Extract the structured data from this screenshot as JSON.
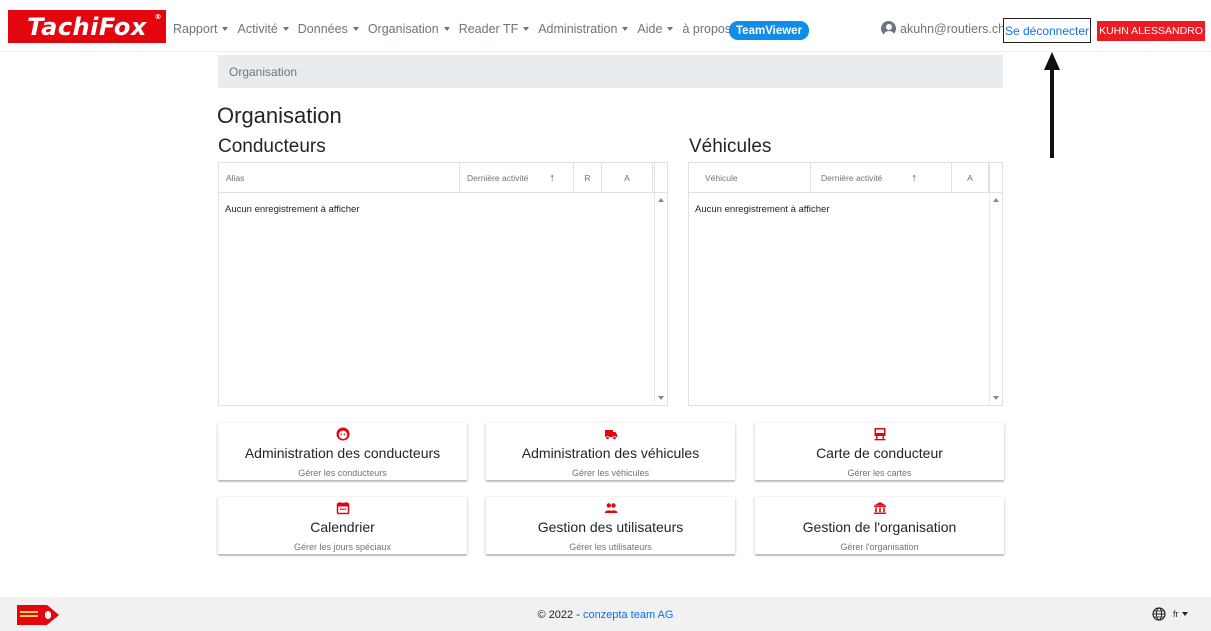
{
  "brand": {
    "logo_text": "TachiFox",
    "reg_mark": "®"
  },
  "nav": {
    "items": [
      {
        "label": "Rapport"
      },
      {
        "label": "Activité"
      },
      {
        "label": "Données"
      },
      {
        "label": "Organisation"
      },
      {
        "label": "Reader TF"
      },
      {
        "label": "Administration"
      },
      {
        "label": "Aide"
      },
      {
        "label": "à propos"
      }
    ],
    "teamviewer_label": "TeamViewer",
    "user_email": "akuhn@routiers.ch",
    "logout_label": "Se déconnecter",
    "user_name": "KUHN ALESSANDRO"
  },
  "breadcrumb": {
    "current": "Organisation"
  },
  "page": {
    "title": "Organisation"
  },
  "drivers": {
    "title": "Conducteurs",
    "columns": [
      "Alias",
      "Dernière activité",
      "↑",
      "R",
      "A"
    ],
    "empty_text": "Aucun enregistrement à afficher"
  },
  "vehicles": {
    "title": "Véhicules",
    "columns": [
      "Véhicule",
      "Dernière activité",
      "↑",
      "A"
    ],
    "empty_text": "Aucun enregistrement à afficher"
  },
  "cards": [
    {
      "icon": "driver-face-icon",
      "title": "Administration des conducteurs",
      "subtitle": "Gérer les conducteurs"
    },
    {
      "icon": "truck-icon",
      "title": "Administration des véhicules",
      "subtitle": "Gérer les véhicules"
    },
    {
      "icon": "card-reader-icon",
      "title": "Carte de conducteur",
      "subtitle": "Gérer les cartes"
    },
    {
      "icon": "calendar-icon",
      "title": "Calendrier",
      "subtitle": "Gérer les jours spéciaux"
    },
    {
      "icon": "users-icon",
      "title": "Gestion des utilisateurs",
      "subtitle": "Gérer les utilisateurs"
    },
    {
      "icon": "bank-icon",
      "title": "Gestion de l'organisation",
      "subtitle": "Gérer l'organisation"
    }
  ],
  "footer": {
    "copyright": "© 2022 - ",
    "company_link": "conzepta team AG",
    "language": "fr"
  },
  "colors": {
    "brand_red": "#e3060f",
    "link_blue": "#0d6efd",
    "teamviewer_blue": "#0e8ee9"
  }
}
